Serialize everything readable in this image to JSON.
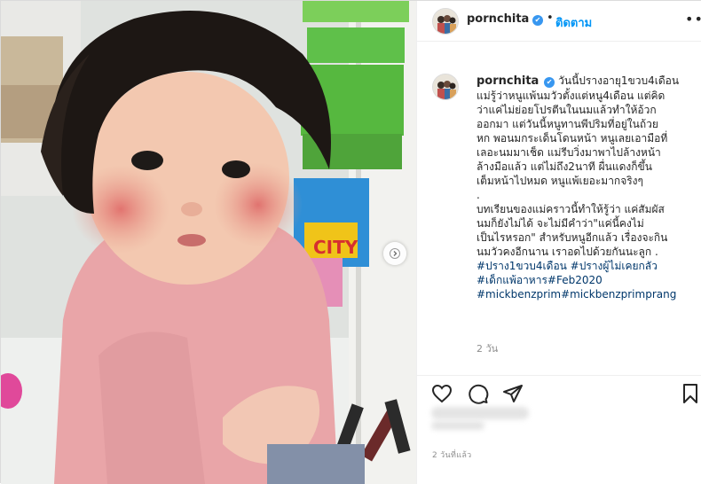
{
  "header": {
    "username": "pornchita",
    "verified_mark": "✔",
    "separator": "•",
    "follow_label": "ติดตาม",
    "more_label": "•••"
  },
  "caption": {
    "username": "pornchita",
    "lines": [
      "วันนี้ปรางอายุ1ขวบ4เดือน",
      "แม่รู้ว่าหนูแพ้นมวัวตั้งแต่หนู4เดือน แต่คิด",
      "ว่าแค่ไม่ย่อยโปรตีนในนมแล้วทำให้อ้วก",
      "ออกมา แต่วันนี้หนูทานพีปริมที่อยู่ในถ้วย",
      "หก พอนมกระเด็นโดนหน้า หนูเลยเอามือที่",
      "เลอะนมมาเช็ด แม่รีบวิ่งมาพาไปล้างหน้า",
      "ล้างมือแล้ว แต่ไม่ถึง2นาที ผื่นแดงก็ขึ้น",
      "เต็มหน้าไปหมด หนูแพ้เยอะมากจริงๆ",
      ".",
      "บทเรียนของแม่คราวนี้ทำให้รู้ว่า แค่สัมผัส",
      "นมก็ยังไม่ได้ จะไม่มีคำว่า\"แค่นี้คงไม่",
      "เป็นไรหรอก\" สำหรับหนูอีกแล้ว เรื่องจะกิน",
      "นมวัวคงอีกนาน เราอดไปด้วยกันนะลูก ."
    ],
    "hashtags": [
      "#ปราง1ขวบ4เดือน #ปรางผู้ไม่เคยกลัว",
      "#เด็กแพ้อาหาร#Feb2020",
      "#mickbenzprim#mickbenzprimprang"
    ],
    "age": "2 วัน"
  },
  "footer": {
    "timestamp": "2 วันที่แล้ว"
  },
  "icons": {
    "like": "heart-icon",
    "comment": "comment-icon",
    "share": "paper-plane-icon",
    "save": "bookmark-icon",
    "next": "chevron-right-icon"
  },
  "colors": {
    "link": "#00376b",
    "follow": "#0095f6",
    "verified": "#3897f0",
    "muted": "#8e8e8e"
  }
}
